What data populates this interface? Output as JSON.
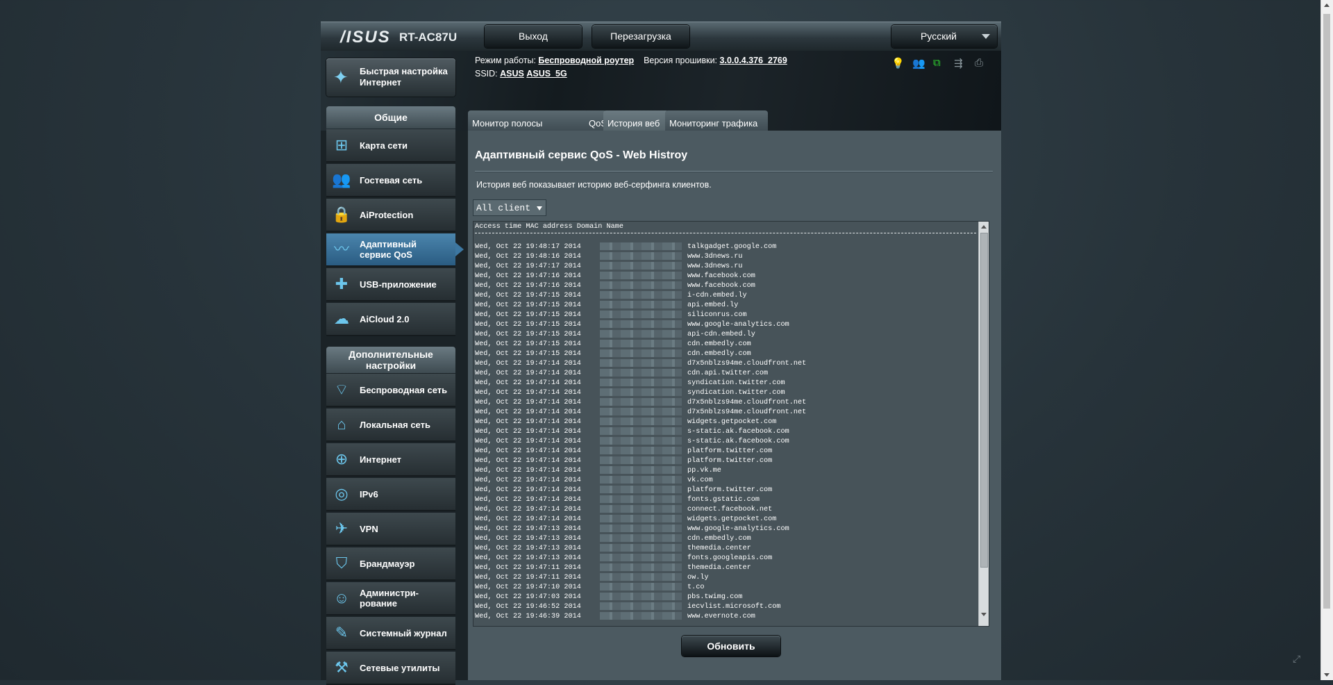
{
  "header": {
    "logo": "/ISUS",
    "model": "RT-AC87U",
    "logout_label": "Выход",
    "reboot_label": "Перезагрузка",
    "language": "Русский"
  },
  "info": {
    "mode_label": "Режим работы:",
    "mode_value": "Беспроводной роутер",
    "fw_label": "Версия прошивки:",
    "fw_value": "3.0.0.4.376_2769",
    "ssid_label": "SSID:",
    "ssid_1": "ASUS",
    "ssid_2": "ASUS_5G"
  },
  "quick_setup": {
    "label": "Быстрая настройка Интернет"
  },
  "sidebar": {
    "general_title": "Общие",
    "general": [
      {
        "label": "Карта сети",
        "icon": "network-map-icon",
        "glyph": "⊞"
      },
      {
        "label": "Гостевая сеть",
        "icon": "guest-network-icon",
        "glyph": "👥"
      },
      {
        "label": "AiProtection",
        "icon": "lock-icon",
        "glyph": "🔒"
      },
      {
        "label": "Адаптивный сервис QoS",
        "icon": "qos-chart-icon",
        "glyph": "〰",
        "active": true
      },
      {
        "label": "USB-приложение",
        "icon": "puzzle-icon",
        "glyph": "✚"
      },
      {
        "label": "AiCloud 2.0",
        "icon": "cloud-icon",
        "glyph": "☁"
      }
    ],
    "advanced_title": "Дополнительные настройки",
    "advanced": [
      {
        "label": "Беспроводная сеть",
        "icon": "wifi-icon",
        "glyph": "⌔"
      },
      {
        "label": "Локальная сеть",
        "icon": "home-icon",
        "glyph": "⌂"
      },
      {
        "label": "Интернет",
        "icon": "globe-icon",
        "glyph": "⊕"
      },
      {
        "label": "IPv6",
        "icon": "ipv6-icon",
        "glyph": "◎"
      },
      {
        "label": "VPN",
        "icon": "vpn-icon",
        "glyph": "✈"
      },
      {
        "label": "Брандмауэр",
        "icon": "shield-icon",
        "glyph": "⛉"
      },
      {
        "label": "Администри-рование",
        "icon": "admin-user-icon",
        "glyph": "☺"
      },
      {
        "label": "Системный журнал",
        "icon": "log-edit-icon",
        "glyph": "✎"
      },
      {
        "label": "Сетевые утилиты",
        "icon": "tools-icon",
        "glyph": "⚒"
      }
    ]
  },
  "tabs": [
    {
      "label": "Монитор полосы пропускания"
    },
    {
      "label": "QoS"
    },
    {
      "label": "История веб",
      "active": true
    },
    {
      "label": "Мониторинг трафика"
    }
  ],
  "main": {
    "title": "Адаптивный сервис QoS - Web Histroy",
    "description": "История веб показывает историю веб-серфинга клиентов.",
    "client_select": "All client",
    "log_header": "Access time MAC address Domain Name",
    "refresh_label": "Обновить",
    "rows": [
      {
        "t": "Wed, Oct 22 19:48:17 2014",
        "d": "talkgadget.google.com"
      },
      {
        "t": "Wed, Oct 22 19:48:16 2014",
        "d": "www.3dnews.ru"
      },
      {
        "t": "Wed, Oct 22 19:47:17 2014",
        "d": "www.3dnews.ru"
      },
      {
        "t": "Wed, Oct 22 19:47:16 2014",
        "d": "www.facebook.com"
      },
      {
        "t": "Wed, Oct 22 19:47:16 2014",
        "d": "www.facebook.com"
      },
      {
        "t": "Wed, Oct 22 19:47:15 2014",
        "d": "i-cdn.embed.ly"
      },
      {
        "t": "Wed, Oct 22 19:47:15 2014",
        "d": "api.embed.ly"
      },
      {
        "t": "Wed, Oct 22 19:47:15 2014",
        "d": "siliconrus.com"
      },
      {
        "t": "Wed, Oct 22 19:47:15 2014",
        "d": "www.google-analytics.com"
      },
      {
        "t": "Wed, Oct 22 19:47:15 2014",
        "d": "api-cdn.embed.ly"
      },
      {
        "t": "Wed, Oct 22 19:47:15 2014",
        "d": "cdn.embedly.com"
      },
      {
        "t": "Wed, Oct 22 19:47:15 2014",
        "d": "cdn.embedly.com"
      },
      {
        "t": "Wed, Oct 22 19:47:14 2014",
        "d": "d7x5nblzs94me.cloudfront.net"
      },
      {
        "t": "Wed, Oct 22 19:47:14 2014",
        "d": "cdn.api.twitter.com"
      },
      {
        "t": "Wed, Oct 22 19:47:14 2014",
        "d": "syndication.twitter.com"
      },
      {
        "t": "Wed, Oct 22 19:47:14 2014",
        "d": "syndication.twitter.com"
      },
      {
        "t": "Wed, Oct 22 19:47:14 2014",
        "d": "d7x5nblzs94me.cloudfront.net"
      },
      {
        "t": "Wed, Oct 22 19:47:14 2014",
        "d": "d7x5nblzs94me.cloudfront.net"
      },
      {
        "t": "Wed, Oct 22 19:47:14 2014",
        "d": "widgets.getpocket.com"
      },
      {
        "t": "Wed, Oct 22 19:47:14 2014",
        "d": "s-static.ak.facebook.com"
      },
      {
        "t": "Wed, Oct 22 19:47:14 2014",
        "d": "s-static.ak.facebook.com"
      },
      {
        "t": "Wed, Oct 22 19:47:14 2014",
        "d": "platform.twitter.com"
      },
      {
        "t": "Wed, Oct 22 19:47:14 2014",
        "d": "platform.twitter.com"
      },
      {
        "t": "Wed, Oct 22 19:47:14 2014",
        "d": "pp.vk.me"
      },
      {
        "t": "Wed, Oct 22 19:47:14 2014",
        "d": "vk.com"
      },
      {
        "t": "Wed, Oct 22 19:47:14 2014",
        "d": "platform.twitter.com"
      },
      {
        "t": "Wed, Oct 22 19:47:14 2014",
        "d": "fonts.gstatic.com"
      },
      {
        "t": "Wed, Oct 22 19:47:14 2014",
        "d": "connect.facebook.net"
      },
      {
        "t": "Wed, Oct 22 19:47:14 2014",
        "d": "widgets.getpocket.com"
      },
      {
        "t": "Wed, Oct 22 19:47:13 2014",
        "d": "www.google-analytics.com"
      },
      {
        "t": "Wed, Oct 22 19:47:13 2014",
        "d": "cdn.embedly.com"
      },
      {
        "t": "Wed, Oct 22 19:47:13 2014",
        "d": "themedia.center"
      },
      {
        "t": "Wed, Oct 22 19:47:13 2014",
        "d": "fonts.googleapis.com"
      },
      {
        "t": "Wed, Oct 22 19:47:11 2014",
        "d": "themedia.center"
      },
      {
        "t": "Wed, Oct 22 19:47:11 2014",
        "d": "ow.ly"
      },
      {
        "t": "Wed, Oct 22 19:47:10 2014",
        "d": "t.co"
      },
      {
        "t": "Wed, Oct 22 19:47:03 2014",
        "d": "pbs.twimg.com"
      },
      {
        "t": "Wed, Oct 22 19:46:52 2014",
        "d": "iecvlist.microsoft.com"
      },
      {
        "t": "Wed, Oct 22 19:46:39 2014",
        "d": "www.evernote.com"
      }
    ]
  },
  "status_icons": [
    {
      "icon": "lightbulb-icon",
      "glyph": "💡",
      "color": "#f2c200"
    },
    {
      "icon": "clients-icon",
      "glyph": "👥",
      "color": "#8a979d"
    },
    {
      "icon": "network-status-icon",
      "glyph": "⧉",
      "color": "#2fd12f"
    },
    {
      "icon": "usb-icon",
      "glyph": "⇶",
      "color": "#8a979d"
    },
    {
      "icon": "printer-icon",
      "glyph": "⎙",
      "color": "#8a979d"
    }
  ]
}
